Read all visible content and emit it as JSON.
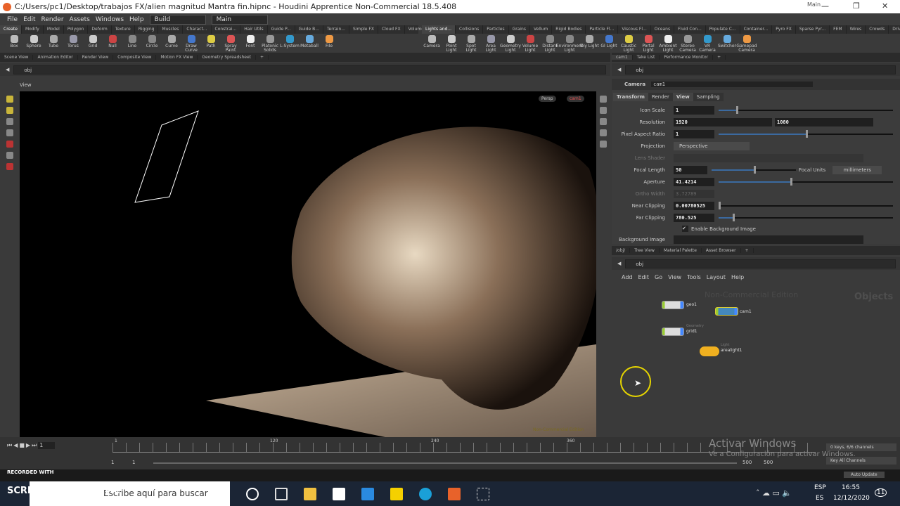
{
  "window": {
    "title": "C:/Users/pc1/Desktop/trabajos FX/alien magnitud Mantra fin.hipnc - Houdini Apprentice Non-Commercial 18.5.408",
    "desktop_label": "Main"
  },
  "menu": [
    "File",
    "Edit",
    "Render",
    "Assets",
    "Windows",
    "Help"
  ],
  "desktop": {
    "build": "Build",
    "main": "Main"
  },
  "shelf_tabs_left": [
    "Create",
    "Modify",
    "Model",
    "Polygon",
    "Deform",
    "Texture",
    "Rigging",
    "Muscles",
    "Charact...",
    "Constrai...",
    "Hair Utils",
    "Guide P...",
    "Guide B...",
    "Terrain...",
    "Simple FX",
    "Cloud FX",
    "Volume"
  ],
  "shelf_tools_left": [
    "Box",
    "Sphere",
    "Tube",
    "Torus",
    "Grid",
    "Null",
    "Line",
    "Circle",
    "Curve",
    "Draw Curve",
    "Path",
    "Spray Paint",
    "Font",
    "Platonic Solids",
    "L-System",
    "Metaball",
    "File"
  ],
  "shelf_tabs_right": [
    "Lights and...",
    "Collisions",
    "Particles",
    "Grains",
    "Vellum",
    "Rigid Bodies",
    "Particle Fl...",
    "Viscous Fl...",
    "Oceans",
    "Fluid Con...",
    "Populate C...",
    "Container...",
    "Pyro FX",
    "Sparse Pyr...",
    "FEM",
    "Wires",
    "Crowds",
    "Drive Sim..."
  ],
  "shelf_tools_right": [
    "Camera",
    "Point Light",
    "Spot Light",
    "Area Light",
    "Geometry Light",
    "Volume Light",
    "Distant Light",
    "Environment Light",
    "Sky Light",
    "GI Light",
    "Caustic Light",
    "Portal Light",
    "Ambient Light",
    "Stereo Camera",
    "VR Camera",
    "Switcher",
    "Gamepad Camera"
  ],
  "left_pane_tabs": [
    "Scene View",
    "Animation Editor",
    "Render View",
    "Composite View",
    "Motion FX View",
    "Geometry Spreadsheet"
  ],
  "right_pane_tabs": [
    "cam1",
    "Take List",
    "Performance Monitor"
  ],
  "path": "obj",
  "viewport": {
    "title": "View",
    "persp": "Persp",
    "camera": "cam1",
    "watermark": "Non-Commercial Edition"
  },
  "params": {
    "node_type": "Camera",
    "node_name": "cam1",
    "tabs": [
      "Transform",
      "Render",
      "View",
      "Sampling"
    ],
    "icon_scale": {
      "label": "Icon Scale",
      "value": "1",
      "fraction": 0.1
    },
    "resolution": {
      "label": "Resolution",
      "x": "1920",
      "y": "1080"
    },
    "pixel_aspect": {
      "label": "Pixel Aspect Ratio",
      "value": "1",
      "fraction": 0.5
    },
    "projection": {
      "label": "Projection",
      "value": "Perspective"
    },
    "lens_shader": {
      "label": "Lens Shader"
    },
    "focal_length": {
      "label": "Focal Length",
      "value": "50",
      "fraction": 0.5,
      "units_label": "Focal Units",
      "units": "millimeters"
    },
    "aperture": {
      "label": "Aperture",
      "value": "41.4214",
      "fraction": 0.41
    },
    "ortho_width": {
      "label": "Ortho Width",
      "value": "3.72789"
    },
    "near_clipping": {
      "label": "Near Clipping",
      "value": "0.00780525",
      "fraction": 0.0
    },
    "far_clipping": {
      "label": "Far Clipping",
      "value": "780.525",
      "fraction": 0.08
    },
    "enable_bg": {
      "label": "Enable Background Image",
      "checked": true
    },
    "bg_image": {
      "label": "Background Image"
    }
  },
  "bottom_pane_tabs": [
    "/obj/",
    "Tree View",
    "Material Palette",
    "Asset Browser"
  ],
  "network": {
    "menu": [
      "Add",
      "Edit",
      "Go",
      "View",
      "Tools",
      "Layout",
      "Help"
    ],
    "watermark": "Non-Commercial Edition",
    "context": "Objects",
    "nodes": [
      {
        "name": "geo1",
        "type": ""
      },
      {
        "name": "cam1",
        "type": ""
      },
      {
        "name": "grid1",
        "type": "Geometry"
      },
      {
        "name": "arealight1",
        "type": "Light"
      }
    ]
  },
  "timeline": {
    "frame": "1",
    "ticks": [
      "1",
      "120",
      "240",
      "360"
    ],
    "start": "1",
    "start2": "1",
    "end": "500",
    "end2": "500",
    "keys": "0 keys, 6/6 channels",
    "key_all": "Key All Channels",
    "auto_update": "Auto Update"
  },
  "overlay": {
    "recorded": "RECORDED WITH",
    "brand": "SCREENCAST-O-MATIC",
    "activate_title": "Activar Windows",
    "activate_sub": "Ve a Configuración para activar Windows."
  },
  "taskbar": {
    "search": "Escribe aquí para buscar",
    "lang1": "ESP",
    "lang2": "ES",
    "time": "16:55",
    "date": "12/12/2020",
    "notif": "11"
  }
}
